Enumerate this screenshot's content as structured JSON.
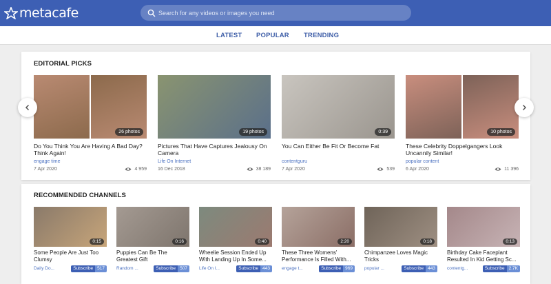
{
  "header": {
    "logo_text": "metacafe",
    "search_placeholder": "Search for any videos or images you need"
  },
  "nav": {
    "tabs": [
      {
        "label": "LATEST"
      },
      {
        "label": "POPULAR"
      },
      {
        "label": "TRENDING"
      }
    ]
  },
  "editorial": {
    "title": "EDITORIAL PICKS",
    "items": [
      {
        "title": "Do You Think You Are Having A Bad Day? Think Again!",
        "source": "engage time",
        "date": "7 Apr 2020",
        "views": "4 959",
        "badge": "26 photos",
        "colors": [
          "#b98a72",
          "#8c6a4c"
        ]
      },
      {
        "title": "Pictures That Have Captures Jealousy On Camera",
        "source": "Life On Internet",
        "date": "16 Dec 2018",
        "views": "38 189",
        "badge": "19 photos",
        "colors": [
          "#8a9470",
          "#5a6f8a"
        ]
      },
      {
        "title": "You Can Either Be Fit Or Become Fat",
        "source": "contentguru",
        "date": "7 Apr 2020",
        "views": "539",
        "badge": "0:39",
        "colors": [
          "#c9c5bf",
          "#9a958e"
        ]
      },
      {
        "title": "These Celebrity Doppelgangers Look Uncannily Similar!",
        "source": "popular content",
        "date": "6 Apr 2020",
        "views": "11 396",
        "badge": "10 photos",
        "colors": [
          "#c98e7e",
          "#7d6258"
        ]
      }
    ]
  },
  "channels": {
    "title": "RECOMMENDED CHANNELS",
    "subscribe_label": "Subscribe",
    "items": [
      {
        "title": "Some People Are Just Too Clumsy",
        "source": "Daily Do...",
        "count": "517",
        "badge": "0:15",
        "colors": [
          "#8a7a6a",
          "#c7a57a"
        ]
      },
      {
        "title": "Puppies Can Be The Greatest Gift",
        "source": "Random ...",
        "count": "507",
        "badge": "0:16",
        "colors": [
          "#a49a92",
          "#7e756d"
        ]
      },
      {
        "title": "Wheelie Session Ended Up With Landing Up In Some...",
        "source": "Life On I...",
        "count": "443",
        "badge": "0:40",
        "colors": [
          "#7d8a7e",
          "#9c7a70"
        ]
      },
      {
        "title": "These Three Womens' Performance Is Filled With...",
        "source": "engage t...",
        "count": "969",
        "badge": "2:20",
        "colors": [
          "#b5a39a",
          "#8b6e66"
        ]
      },
      {
        "title": "Chimpanzee Loves Magic Tricks",
        "source": "popular ...",
        "count": "443",
        "badge": "0:18",
        "colors": [
          "#6f6459",
          "#9e8f82"
        ]
      },
      {
        "title": "Birthday Cake Faceplant Resulted In Kid Getting Sc...",
        "source": "contentg...",
        "count": "2.7K",
        "badge": "0:13",
        "colors": [
          "#a4888a",
          "#c7b3b5"
        ]
      }
    ]
  }
}
